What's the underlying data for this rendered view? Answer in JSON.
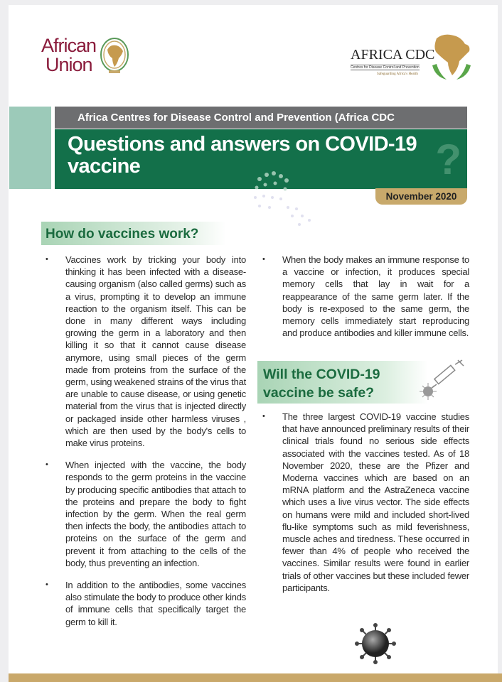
{
  "logos": {
    "au_line1": "African",
    "au_line2": "Union",
    "cdc_title": "AFRICA CDC",
    "cdc_subtitle": "Centres for Disease Control and Prevention",
    "cdc_tagline": "Safeguarding Africa's Health"
  },
  "banner": {
    "organization": "Africa Centres for Disease Control and Prevention (Africa CDC",
    "title": "Questions and answers on COVID-19 vaccine",
    "date": "November 2020"
  },
  "sections": {
    "how_heading": "How do vaccines work?",
    "how_items": [
      "Vaccines work by tricking your body into thinking it has been infected with a disease-causing organism (also called germs) such as a virus, prompting it to develop an immune reaction to the organism itself. This can be done in many different ways including growing the germ in a laboratory and then killing it so that it cannot cause disease anymore, using small pieces of the germ made from proteins from the surface of the germ, using weakened strains of the virus that are unable to cause disease, or using genetic material from the virus that is injected directly or packaged inside other harmless viruses , which are then used by the body's cells to make virus proteins.",
      "When injected with the vaccine, the body responds to the germ proteins in the vaccine by producing specific antibodies that attach to the proteins and prepare the body to fight infection by the germ. When the real germ then infects the body, the antibodies attach to proteins on the surface of the germ and prevent it from attaching to the cells of the body, thus preventing an infection.",
      "In addition to the antibodies, some vaccines also stimulate the body to produce other kinds of immune cells that specifically target the germ to kill it.",
      "When the body makes an immune response to a vaccine or infection, it produces special memory cells that lay in wait for a reappearance of the same germ later. If the body is re-exposed to the same germ, the memory cells immediately start reproducing and produce antibodies and killer immune cells."
    ],
    "safe_heading": "Will the COVID-19 vaccine be safe?",
    "safe_items": [
      "The three largest COVID-19 vaccine studies that have announced preliminary results of their clinical trials found no serious side effects associated with the vaccines tested. As of 18 November 2020, these are the Pfizer and Moderna vaccines which are based on an mRNA platform and the AstraZeneca vaccine which uses a live virus vector. The side effects on humans were mild and included short-lived flu-like symptoms such as mild feverishness, muscle aches and tiredness. These occurred in fewer than 4% of people who received the vaccines. Similar results were found in earlier trials of other vaccines but these included fewer participants."
    ]
  },
  "colors": {
    "green": "#13704a",
    "gray": "#6d6e70",
    "gold": "#c8a96b",
    "teal": "#9ccab9",
    "maroon": "#8a1c3c"
  }
}
